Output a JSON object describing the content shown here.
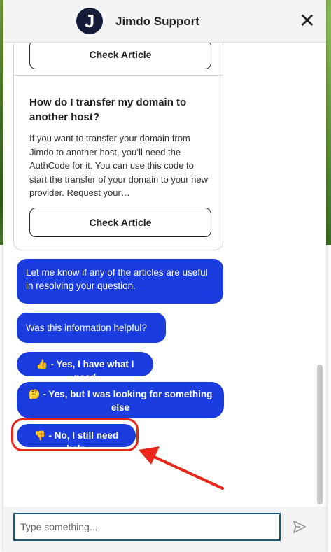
{
  "header": {
    "logo_letter": "J",
    "title": "Jimdo Support",
    "close_symbol": "✕"
  },
  "articles": [
    {
      "button_label": "Check Article"
    },
    {
      "title": "How do I transfer my domain to another host?",
      "excerpt": "If you want to transfer your domain from Jimdo to another host, you’ll need the AuthCode for it. You can use this code to start the transfer of your domain to your new provider. Request your…",
      "button_label": "Check Article"
    }
  ],
  "messages": [
    "Let me know if any of the articles are useful in resolving your question.",
    "Was this information helpful?"
  ],
  "quick_replies": [
    {
      "emoji": "👍",
      "label": "- Yes, I have what I need"
    },
    {
      "emoji": "🤔",
      "label": "- Yes, but I was looking for something else"
    },
    {
      "emoji": "👎",
      "label": "- No, I still need help"
    }
  ],
  "composer": {
    "placeholder": "Type something..."
  },
  "colors": {
    "bubble": "#1b3de0",
    "highlight": "#e8261a",
    "logo_bg": "#141c3a"
  },
  "icons": {
    "send": "send-icon",
    "close": "close-icon"
  }
}
